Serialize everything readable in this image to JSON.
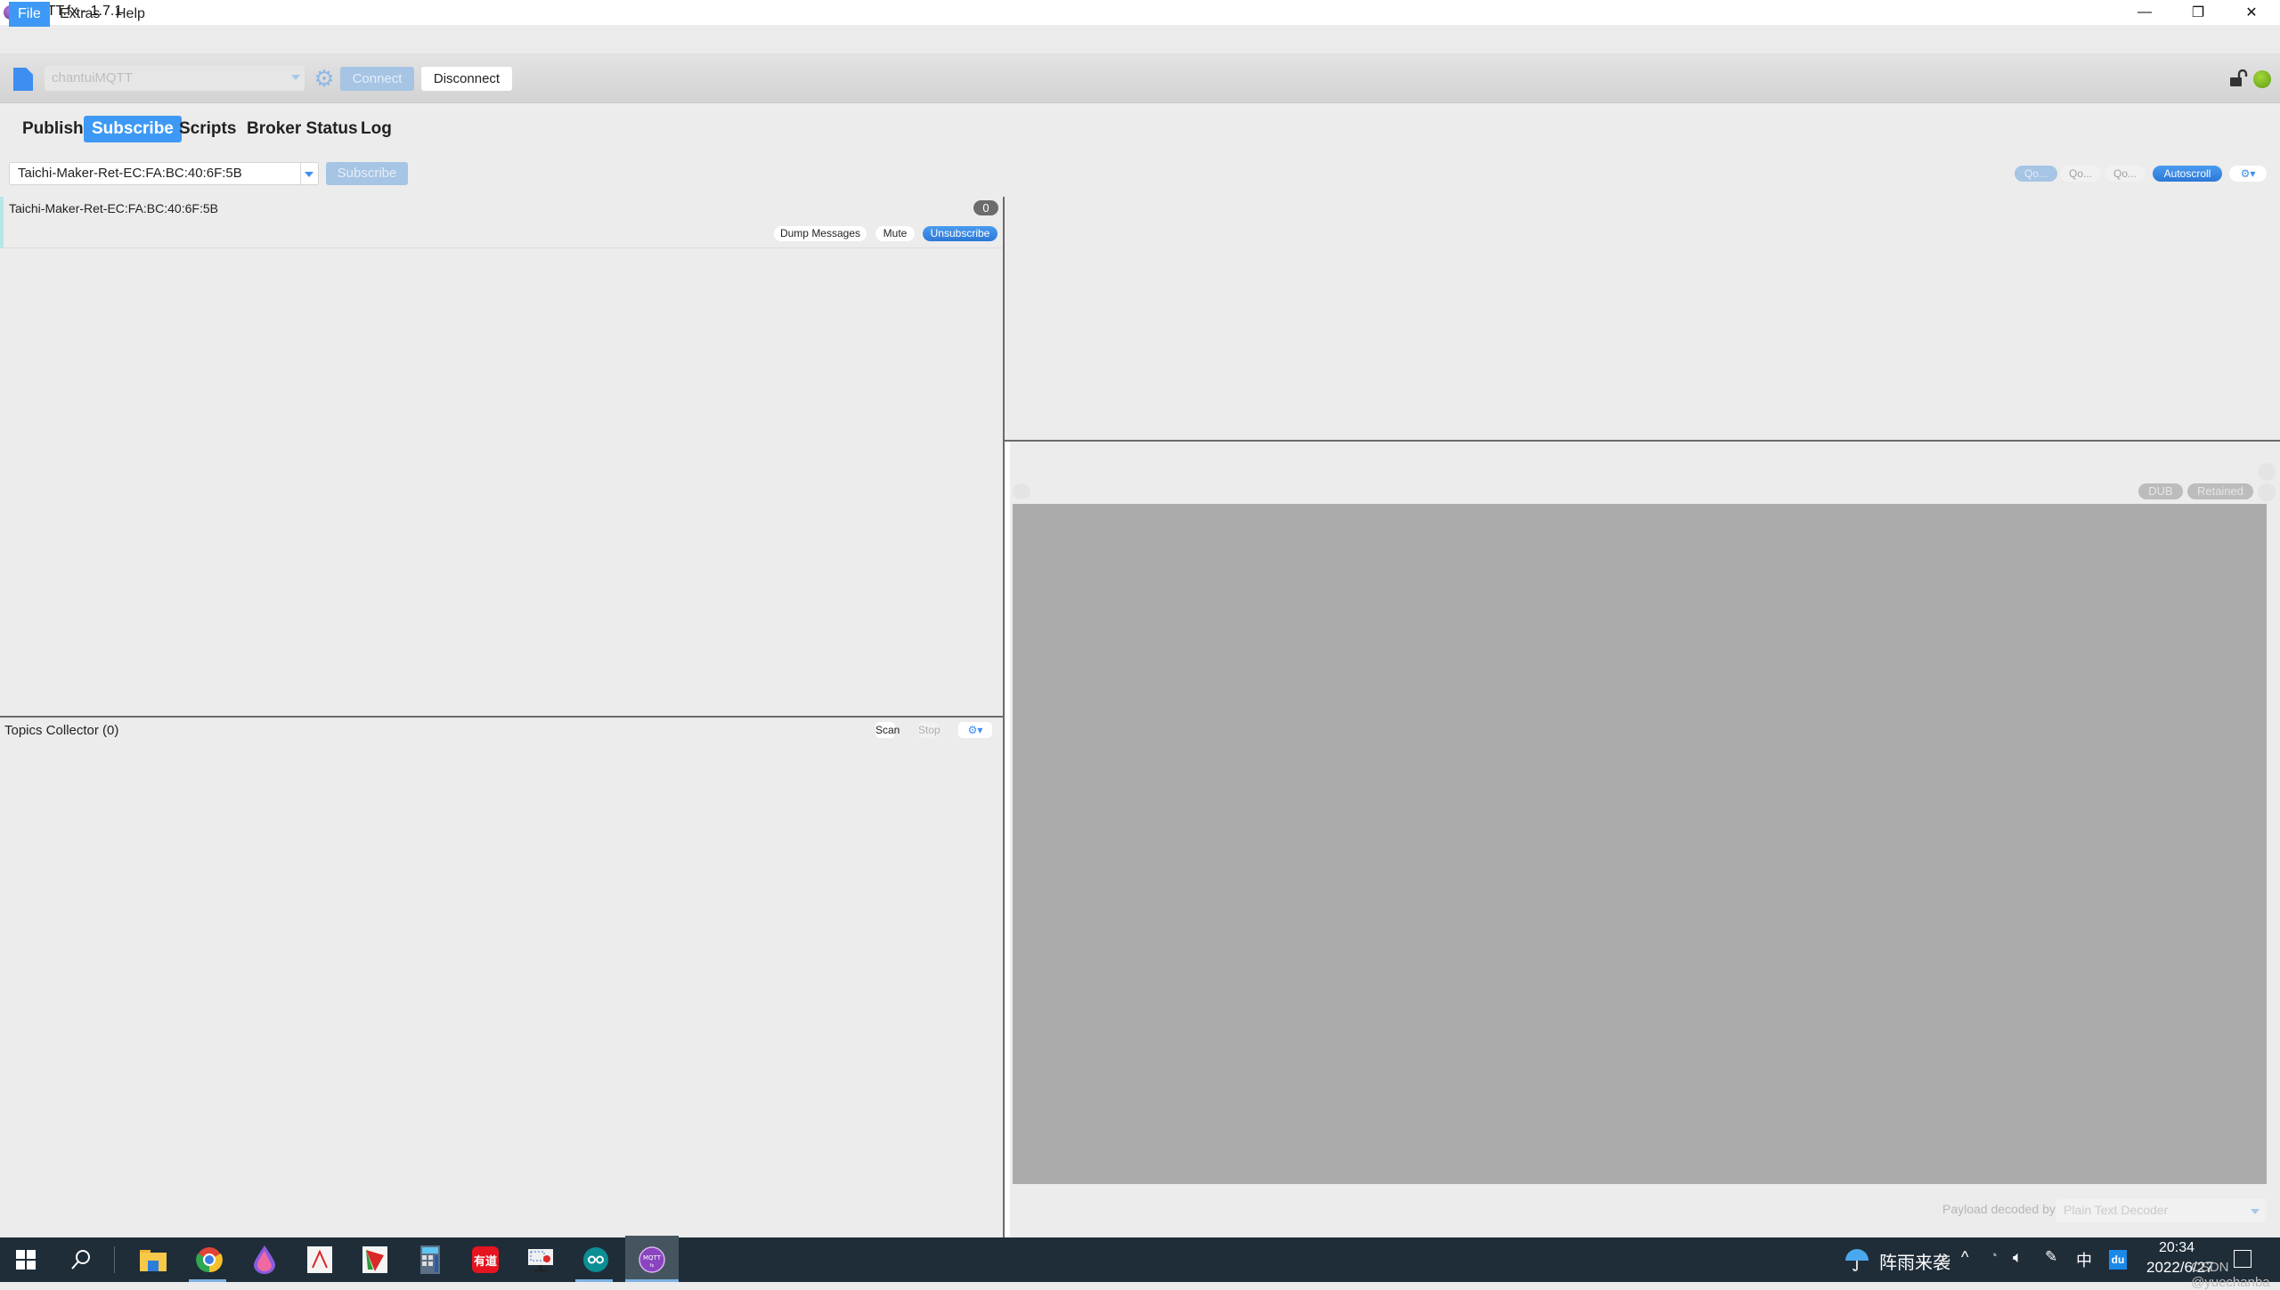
{
  "window": {
    "title": "MQTT.fx - 1.7.1",
    "controls": {
      "minimize": "—",
      "maximize": "❐",
      "close": "✕"
    }
  },
  "menu": {
    "items": [
      {
        "label": "File",
        "active": true
      },
      {
        "label": "Extras",
        "active": false
      },
      {
        "label": "Help",
        "active": false
      }
    ]
  },
  "toolbar": {
    "profile_value": "chantuiMQTT",
    "connect_label": "Connect",
    "disconnect_label": "Disconnect",
    "lock_icon": "unlock-icon",
    "status_color": "#7ec320"
  },
  "tabs": [
    {
      "label": "Publish",
      "active": false
    },
    {
      "label": "Subscribe",
      "active": true
    },
    {
      "label": "Scripts",
      "active": false
    },
    {
      "label": "Broker Status",
      "active": false
    },
    {
      "label": "Log",
      "active": false
    }
  ],
  "subscribe": {
    "topic_input_value": "Taichi-Maker-Ret-EC:FA:BC:40:6F:5B",
    "subscribe_label": "Subscribe",
    "qos_buttons": [
      "Qo...",
      "Qo...",
      "Qo..."
    ],
    "autoscroll_label": "Autoscroll",
    "options_icon": "⚙▾"
  },
  "subscriptions": [
    {
      "topic": "Taichi-Maker-Ret-EC:FA:BC:40:6F:5B",
      "message_count": "0",
      "dump_label": "Dump Messages",
      "mute_label": "Mute",
      "unsubscribe_label": "Unsubscribe"
    }
  ],
  "topics_collector": {
    "label": "Topics Collector (0)",
    "scan_label": "Scan",
    "stop_label": "Stop",
    "options_icon": "⚙▾"
  },
  "message_detail": {
    "dub_label": "DUB",
    "retained_label": "Retained",
    "payload_decoder_label": "Payload decoded by",
    "payload_decoder_value": "Plain Text Decoder"
  },
  "taskbar": {
    "apps": [
      "start",
      "search",
      "file-explorer",
      "chrome",
      "paint-app",
      "acrobat",
      "app-green-red",
      "calculator",
      "youdao",
      "screen-capture",
      "arduino",
      "mqttfx"
    ],
    "youdao_label": "有道",
    "weather_text": "阵雨来袭",
    "tray_caret": "^",
    "ime_label": "中",
    "baidu_label": "du",
    "time": "20:34",
    "date": "2022/6/27",
    "watermark": "CSDN @yuechanba"
  },
  "colors": {
    "accent": "#3d99f5",
    "background": "#ececec",
    "payload_gray": "#ababab",
    "taskbar": "#1f2d39"
  }
}
